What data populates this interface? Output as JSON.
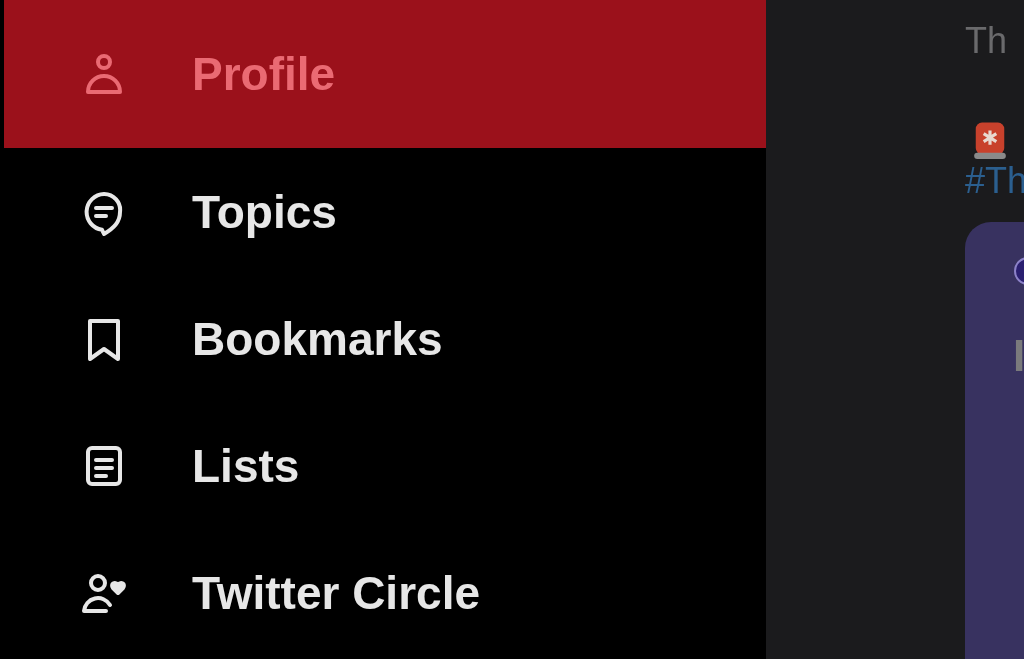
{
  "menu": [
    {
      "kind": "profile",
      "label": "Profile",
      "selected": true
    },
    {
      "kind": "topics",
      "label": "Topics",
      "selected": false
    },
    {
      "kind": "bookmarks",
      "label": "Bookmarks",
      "selected": false
    },
    {
      "kind": "lists",
      "label": "Lists",
      "selected": false
    },
    {
      "kind": "circle",
      "label": "Twitter Circle",
      "selected": false
    }
  ],
  "feed": {
    "text": "Th",
    "hashtag": "#Th",
    "card_lines": [
      "I"
    ]
  }
}
